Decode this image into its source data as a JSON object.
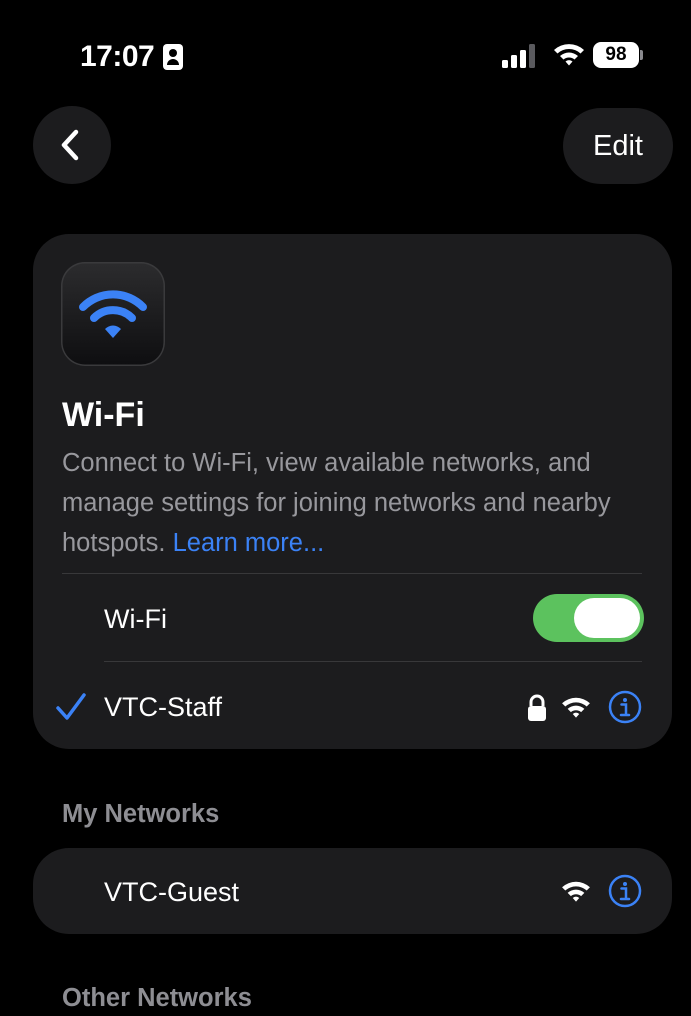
{
  "status_bar": {
    "time": "17:07",
    "battery": "98"
  },
  "nav": {
    "edit_label": "Edit"
  },
  "header": {
    "title": "Wi-Fi",
    "description": "Connect to Wi-Fi, view available networks, and manage settings for joining networks and nearby hotspots.",
    "learn_more": "Learn more..."
  },
  "wifi_toggle": {
    "label": "Wi-Fi",
    "on": true
  },
  "connected_network": {
    "name": "VTC-Staff",
    "secured": true
  },
  "my_networks": {
    "header": "My Networks",
    "items": [
      {
        "name": "VTC-Guest"
      }
    ]
  },
  "other_networks": {
    "header": "Other Networks"
  },
  "colors": {
    "accent": "#3b82f6",
    "toggle_on": "#5cc25e",
    "card": "#1c1c1e"
  },
  "icons": [
    "person-badge-icon",
    "signal-icon",
    "wifi-icon",
    "battery-icon",
    "chevron-left-icon",
    "checkmark-icon",
    "lock-icon",
    "info-icon"
  ]
}
